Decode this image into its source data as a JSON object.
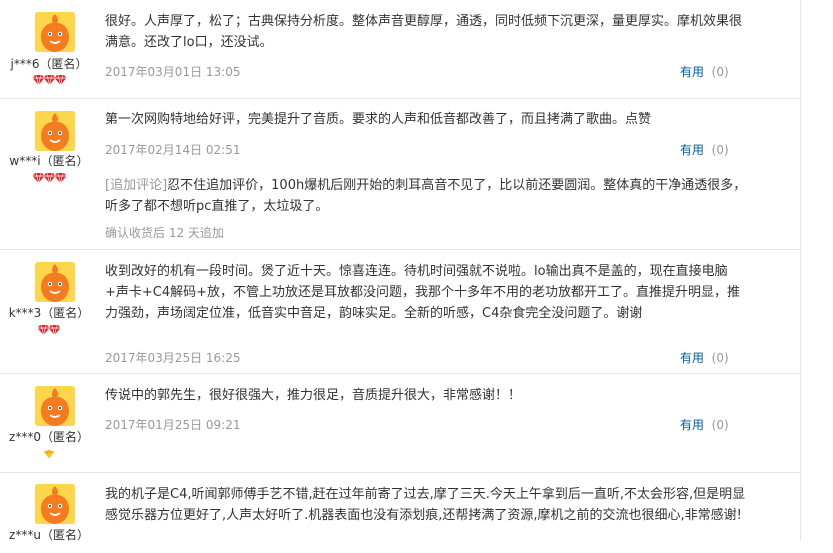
{
  "reviews": [
    {
      "user": "j***6（匿名）",
      "level": "diamond",
      "content": "很好。人声厚了，松了；古典保持分析度。整体声音更醇厚，通透，同时低频下沉更深，量更厚实。摩机效果很满意。还改了lo口，还没试。",
      "date": "2017年03月01日 13:05",
      "useful_label": "有用",
      "useful_count": "(0)"
    },
    {
      "user": "w***i（匿名）",
      "level": "diamond",
      "content": "第一次网购特地给好评，完美提升了音质。要求的人声和低音都改善了，而且拷满了歌曲。点赞",
      "date": "2017年02月14日 02:51",
      "useful_label": "有用",
      "useful_count": "(0)",
      "append_tag": "[追加评论]",
      "append_text": "忍不住追加评价，100h爆机后刚开始的刺耳高音不见了，比以前还要圆润。整体真的干净通透很多，听多了都不想听pc直推了，太垃圾了。",
      "append_meta": "确认收货后 12 天追加"
    },
    {
      "user": "k***3（匿名）",
      "level": "diamond",
      "content": "收到改好的机有一段时间。煲了近十天。惊喜连连。待机时间强就不说啦。lo输出真不是盖的，现在直接电脑+声卡+C4解码+放，不管上功放还是耳放都没问题，我那个十多年不用的老功放都开工了。直推提升明显，推力强劲，声场阔定位准，低音实中音足，韵味实足。全新的听感，C4杂食完全没问题了。谢谢",
      "date": "2017年03月25日 16:25",
      "useful_label": "有用",
      "useful_count": "(0)"
    },
    {
      "user": "z***0（匿名）",
      "level": "heart",
      "content": "传说中的郭先生，很好很强大，推力很足，音质提升很大，非常感谢！！",
      "date": "2017年01月25日 09:21",
      "useful_label": "有用",
      "useful_count": "(0)"
    },
    {
      "user": "z***u（匿名）",
      "level": "diamond",
      "content": "我的机子是C4,听闻郭师傅手艺不错,赶在过年前寄了过去,摩了三天.今天上午拿到后一直听,不太会形容,但是明显感觉乐器方位更好了,人声太好听了.机器表面也没有添划痕,还帮拷满了资源,摩机之前的交流也很细心,非常感谢!",
      "date": "",
      "useful_label": "",
      "useful_count": ""
    }
  ]
}
